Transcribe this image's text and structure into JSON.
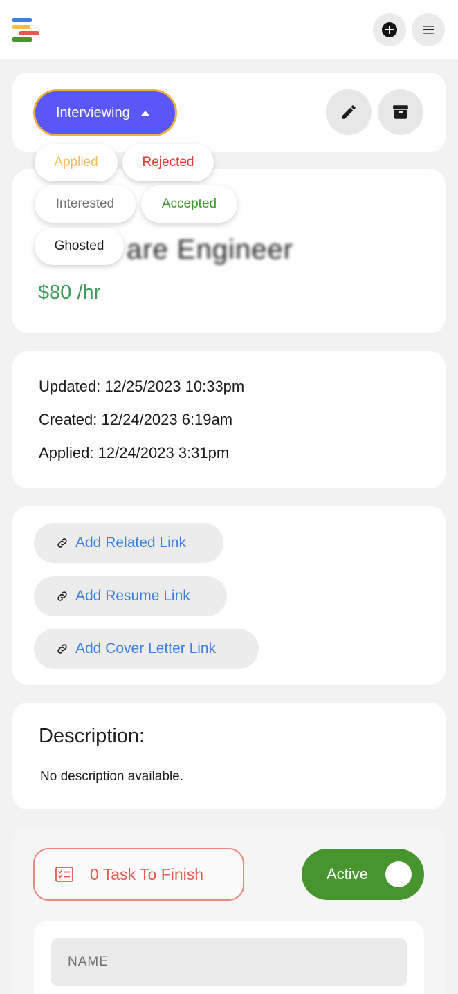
{
  "header": {
    "logo_icon": "app-logo-icon",
    "add_icon": "plus-circle-icon",
    "menu_icon": "hamburger-menu-icon"
  },
  "status": {
    "current": "Interviewing",
    "accent": "#5a57f9",
    "options": [
      {
        "label": "Applied",
        "color": "#f2bf5e"
      },
      {
        "label": "Rejected",
        "color": "#e53935"
      },
      {
        "label": "Interested",
        "color": "#707070"
      },
      {
        "label": "Accepted",
        "color": "#3b9a2b"
      },
      {
        "label": "Ghosted",
        "color": "#1c1c1c"
      }
    ]
  },
  "job": {
    "title_visible": "are Engineer",
    "rate": "$80 /hr"
  },
  "dates": {
    "updated": "Updated: 12/25/2023 10:33pm",
    "created": "Created: 12/24/2023 6:19am",
    "applied": "Applied: 12/24/2023 3:31pm"
  },
  "links": {
    "related": "Add Related Link",
    "resume": "Add Resume Link",
    "cover_letter": "Add Cover Letter Link"
  },
  "description": {
    "title": "Description:",
    "text": "No description available."
  },
  "tasks": {
    "label": "0 Task To Finish",
    "toggle_label": "Active",
    "name_placeholder": "NAME"
  }
}
